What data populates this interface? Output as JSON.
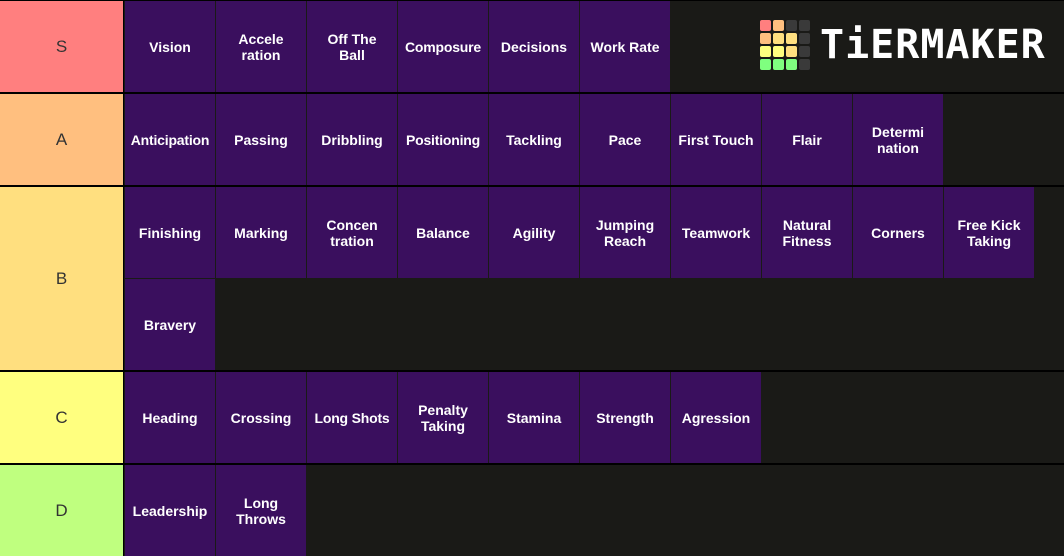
{
  "logo": {
    "text": "TiERMAKER",
    "grid_colors": [
      "#ff7f7f",
      "#ffbf7f",
      "#3a3a3a",
      "#3a3a3a",
      "#ffbf7f",
      "#ffdf7f",
      "#ffdf7f",
      "#3a3a3a",
      "#ffff7f",
      "#ffff7f",
      "#ffdf7f",
      "#3a3a3a",
      "#7fff7f",
      "#7fff7f",
      "#7fff7f",
      "#3a3a3a"
    ]
  },
  "colors": {
    "S": "#ff7f7f",
    "A": "#ffbf7f",
    "B": "#ffdf7f",
    "C": "#ffff7f",
    "D": "#bfff7f",
    "item_bg": "#3a0f5e",
    "row_bg": "#1a1a17"
  },
  "tiers": [
    {
      "label": "S",
      "items": [
        "Vision",
        "Accele\nration",
        "Off The\nBall",
        "Composure",
        "Decisions",
        "Work Rate"
      ]
    },
    {
      "label": "A",
      "items": [
        "Anticipation",
        "Passing",
        "Dribbling",
        "Positioning",
        "Tackling",
        "Pace",
        "First Touch",
        "Flair",
        "Determi\nnation"
      ]
    },
    {
      "label": "B",
      "items": [
        "Finishing",
        "Marking",
        "Concen\ntration",
        "Balance",
        "Agility",
        "Jumping\nReach",
        "Teamwork",
        "Natural\nFitness",
        "Corners",
        "Free Kick\nTaking",
        "Bravery"
      ]
    },
    {
      "label": "C",
      "items": [
        "Heading",
        "Crossing",
        "Long Shots",
        "Penalty\nTaking",
        "Stamina",
        "Strength",
        "Agression"
      ]
    },
    {
      "label": "D",
      "items": [
        "Leadership",
        "Long\nThrows"
      ]
    }
  ]
}
